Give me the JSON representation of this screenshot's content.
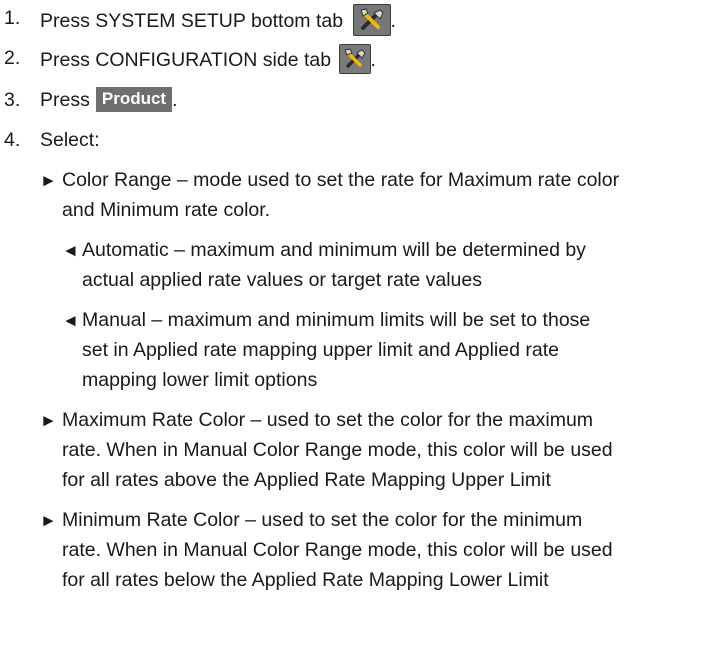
{
  "steps": [
    {
      "number": "1.",
      "text": "Press SYSTEM SETUP bottom tab",
      "suffix": "."
    },
    {
      "number": "2.",
      "text": "Press CONFIGURATION side tab",
      "suffix": "."
    },
    {
      "number": "3.",
      "text": "Press",
      "button": "Product",
      "suffix": "."
    },
    {
      "number": "4.",
      "text": "Select:"
    }
  ],
  "options": [
    {
      "marker": "►",
      "lines": [
        "Color Range – mode used to set the rate for Maximum rate color",
        "and Minimum rate color."
      ],
      "sub": [
        {
          "marker": "◄",
          "lines": [
            "Automatic – maximum and minimum will be determined by",
            "actual applied rate values or target rate values"
          ]
        },
        {
          "marker": "◄",
          "lines": [
            "Manual – maximum and minimum limits will be set to those",
            "set in Applied rate mapping upper limit and Applied rate",
            "mapping lower limit options"
          ]
        }
      ]
    },
    {
      "marker": "►",
      "lines": [
        "Maximum Rate Color – used to set the color for the maximum",
        "rate. When in Manual Color Range mode, this color will be used",
        "for all rates above the Applied Rate Mapping Upper Limit"
      ]
    },
    {
      "marker": "►",
      "lines": [
        "Minimum Rate Color – used to set the color for the minimum",
        "rate. When in Manual Color Range mode, this color will be used",
        "for all rates below the Applied Rate Mapping Lower Limit"
      ]
    }
  ],
  "icons": {
    "setup_icon": "tools-icon",
    "config_icon": "tools-icon"
  }
}
